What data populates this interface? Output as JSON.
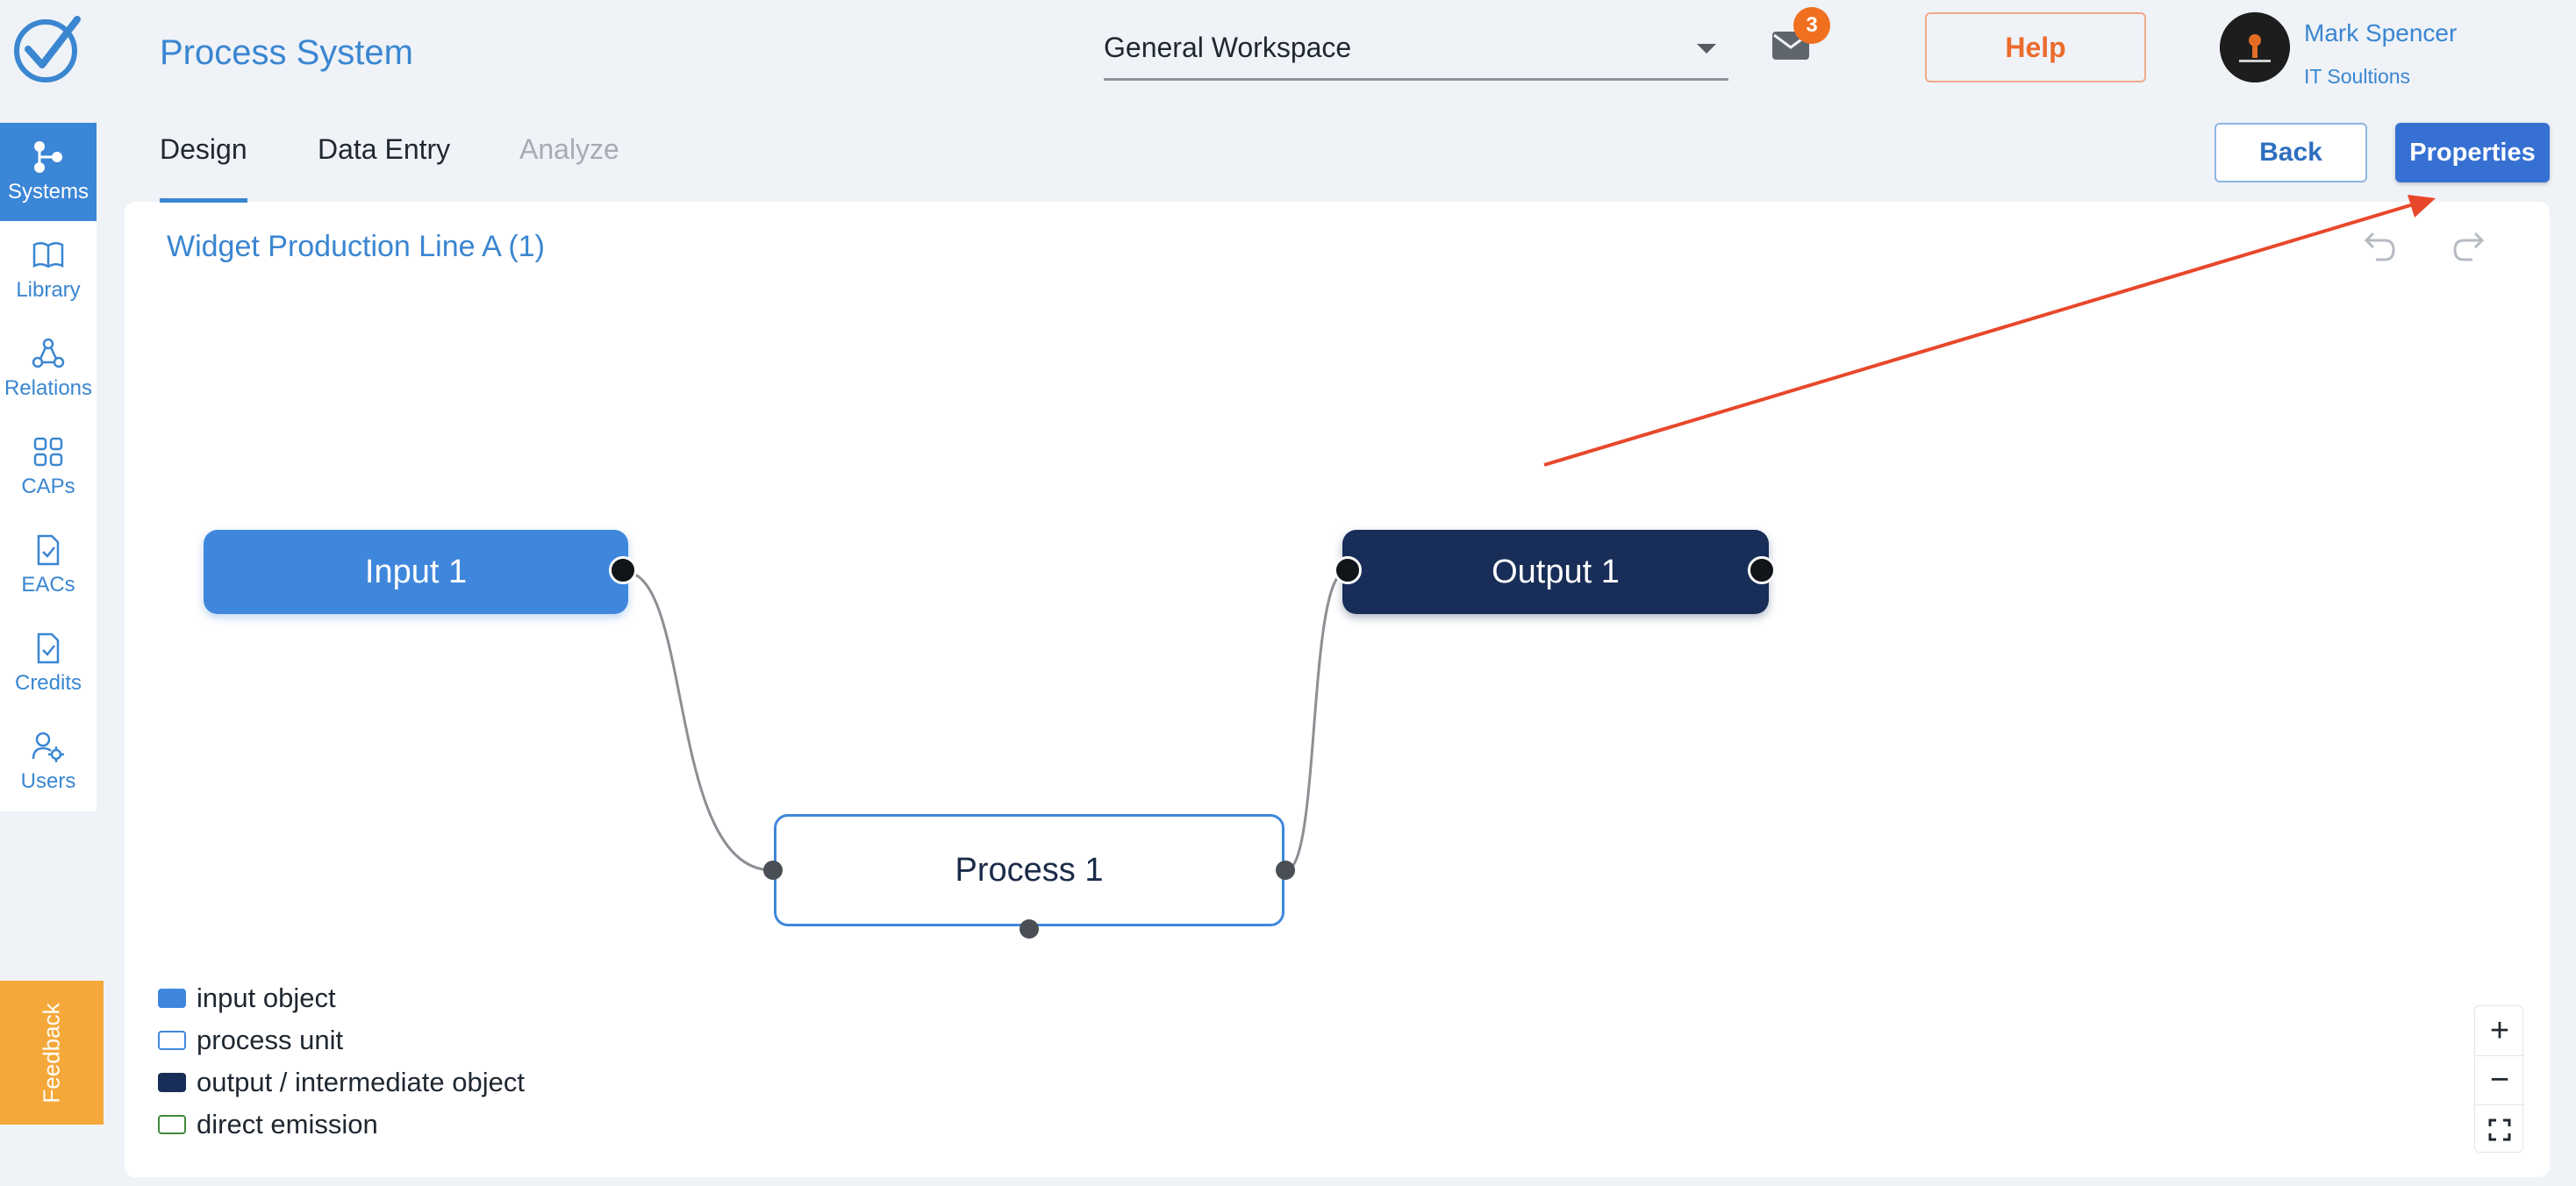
{
  "app": {
    "title": "Process System"
  },
  "sidebar": {
    "items": [
      {
        "label": "Systems",
        "icon": "systems-icon",
        "active": true
      },
      {
        "label": "Library",
        "icon": "book-icon"
      },
      {
        "label": "Relations",
        "icon": "relations-icon"
      },
      {
        "label": "CAPs",
        "icon": "grid-icon"
      },
      {
        "label": "EACs",
        "icon": "document-check-icon"
      },
      {
        "label": "Credits",
        "icon": "document-check-icon"
      },
      {
        "label": "Users",
        "icon": "users-gear-icon"
      }
    ]
  },
  "feedback": {
    "label": "Feedback"
  },
  "header": {
    "workspace": "General Workspace",
    "mail_count": "3",
    "help_label": "Help",
    "user": {
      "name": "Mark Spencer",
      "org": "IT Soultions"
    }
  },
  "tabs": [
    {
      "label": "Design",
      "active": true
    },
    {
      "label": "Data Entry"
    },
    {
      "label": "Analyze",
      "disabled": true
    }
  ],
  "actions": {
    "back_label": "Back",
    "properties_label": "Properties"
  },
  "canvas": {
    "system_title": "Widget Production Line A (1)",
    "nodes": {
      "input": "Input 1",
      "process": "Process 1",
      "output": "Output 1"
    }
  },
  "legend": [
    {
      "label": "input object",
      "color": "#3f87dc",
      "style": "filled"
    },
    {
      "label": "process unit",
      "color": "#3f87dc",
      "style": "outline"
    },
    {
      "label": "output / intermediate object",
      "color": "#182d57",
      "style": "filled"
    },
    {
      "label": "direct emission",
      "color": "#3f8a3a",
      "style": "outline"
    }
  ],
  "zoom": {
    "in": "+",
    "out": "−"
  },
  "colors": {
    "accent": "#3a86d1",
    "primary_button": "#3670d2",
    "help": "#ec6b2d",
    "badge": "#f0701f",
    "feedback": "#f5a83a",
    "annotation_arrow": "#e8472b"
  }
}
